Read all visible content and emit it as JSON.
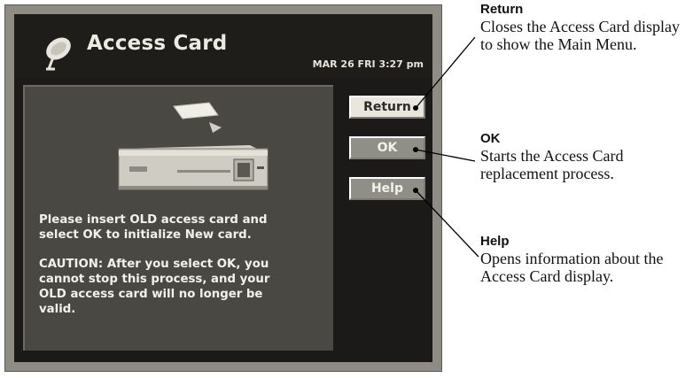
{
  "screen": {
    "title": "Access Card",
    "datetime": "MAR 26 FRI  3:27 pm",
    "message1": "Please insert OLD access card and\nselect OK to initialize New card.",
    "message2": "CAUTION: After you select OK, you\ncannot stop this process, and your\nOLD access card will no longer be\nvalid.",
    "buttons": {
      "return": "Return",
      "ok": "OK",
      "help": "Help"
    },
    "icon": "satellite-dish-icon"
  },
  "callouts": {
    "return": {
      "title": "Return",
      "text": "Closes the Access Card display to show the Main Menu."
    },
    "ok": {
      "title": "OK",
      "text": "Starts the Access Card replacement process."
    },
    "help": {
      "title": "Help",
      "text": "Opens information about the Access Card display."
    }
  },
  "colors": {
    "screen_bg": "#1b1a18",
    "panel_bg": "#4a4843",
    "frame": "#8e8c84",
    "button_light": "#e9e7dd",
    "button_dark": "#8f8e87"
  }
}
